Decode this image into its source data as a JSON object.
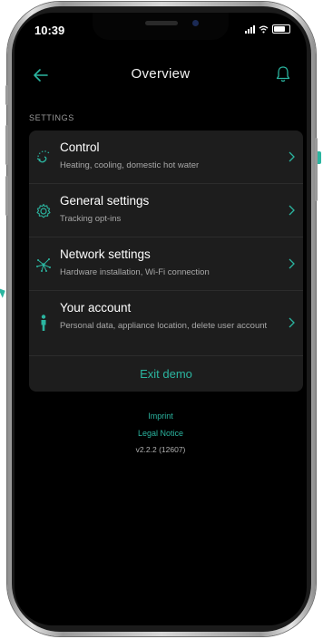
{
  "status_bar": {
    "time": "10:39"
  },
  "nav": {
    "title": "Overview"
  },
  "section": {
    "header": "SETTINGS"
  },
  "settings_items": [
    {
      "title": "Control",
      "subtitle": "Heating, cooling, domestic hot water",
      "icon": "control-icon"
    },
    {
      "title": "General settings",
      "subtitle": "Tracking opt-ins",
      "icon": "gear-icon"
    },
    {
      "title": "Network settings",
      "subtitle": "Hardware installation, Wi-Fi connection",
      "icon": "network-icon"
    },
    {
      "title": "Your account",
      "subtitle": "Personal data, appliance location, delete user account",
      "icon": "person-icon"
    }
  ],
  "exit_demo_label": "Exit demo",
  "footer": {
    "imprint": "Imprint",
    "legal_notice": "Legal Notice",
    "version": "v2.2.2 (12607)"
  },
  "colors": {
    "accent": "#2bb5a0",
    "background": "#000000",
    "card": "#1d1d1d"
  }
}
